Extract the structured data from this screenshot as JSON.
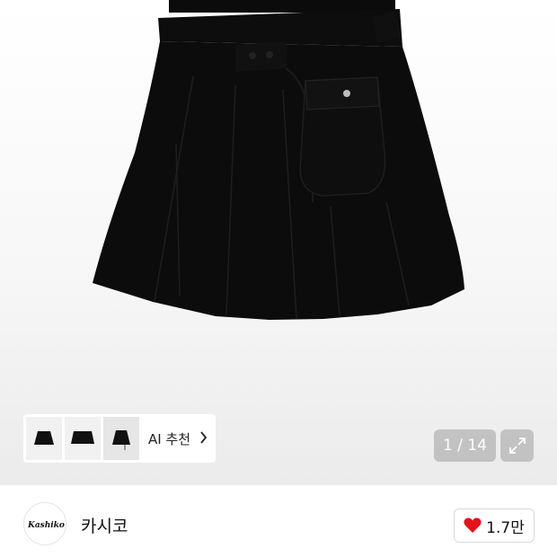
{
  "gallery": {
    "counter": "1 / 14",
    "ai_recommend_label": "AI 추천",
    "thumbnails": [
      "skirt-thumb-1",
      "skirt-thumb-2",
      "skirt-thumb-3"
    ]
  },
  "brand": {
    "name": "카시코",
    "logo_text": "Kashiko"
  },
  "like": {
    "count": "1.7만",
    "heart_color": "#e5111b"
  },
  "icons": {
    "expand": "expand-icon",
    "chevron": "chevron-right-icon",
    "heart": "heart-icon"
  }
}
